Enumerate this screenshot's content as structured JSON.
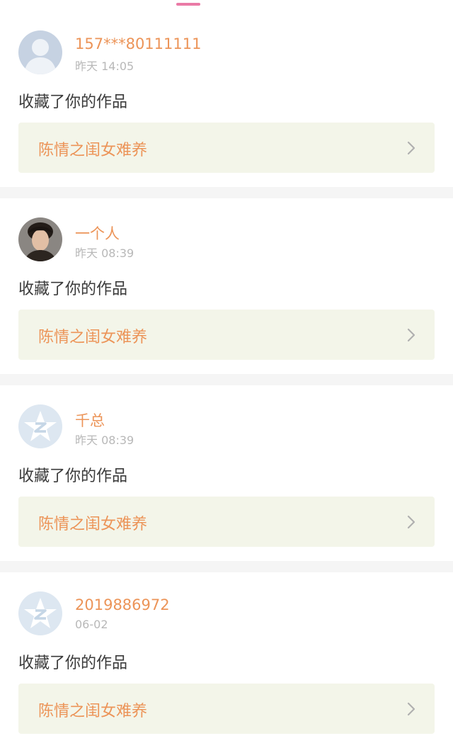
{
  "notifications": [
    {
      "username": "157***80111111",
      "time": "昨天 14:05",
      "action": "收藏了你的作品",
      "work_title": "陈情之闺女难养",
      "avatar": "default-person-avatar"
    },
    {
      "username": "一个人",
      "time": "昨天 08:39",
      "action": "收藏了你的作品",
      "work_title": "陈情之闺女难养",
      "avatar": "photo-avatar"
    },
    {
      "username": "千总",
      "time": "昨天 08:39",
      "action": "收藏了你的作品",
      "work_title": "陈情之闺女难养",
      "avatar": "qzone-star-avatar"
    },
    {
      "username": "2019886972",
      "time": "06-02",
      "action": "收藏了你的作品",
      "work_title": "陈情之闺女难养",
      "avatar": "qzone-star-avatar"
    }
  ],
  "colors": {
    "accent": "#ec9458",
    "tab_indicator": "#ea7aa6",
    "card_background": "#f3f5e9",
    "separator": "#f5f5f5",
    "muted_text": "#b8b8b8"
  }
}
